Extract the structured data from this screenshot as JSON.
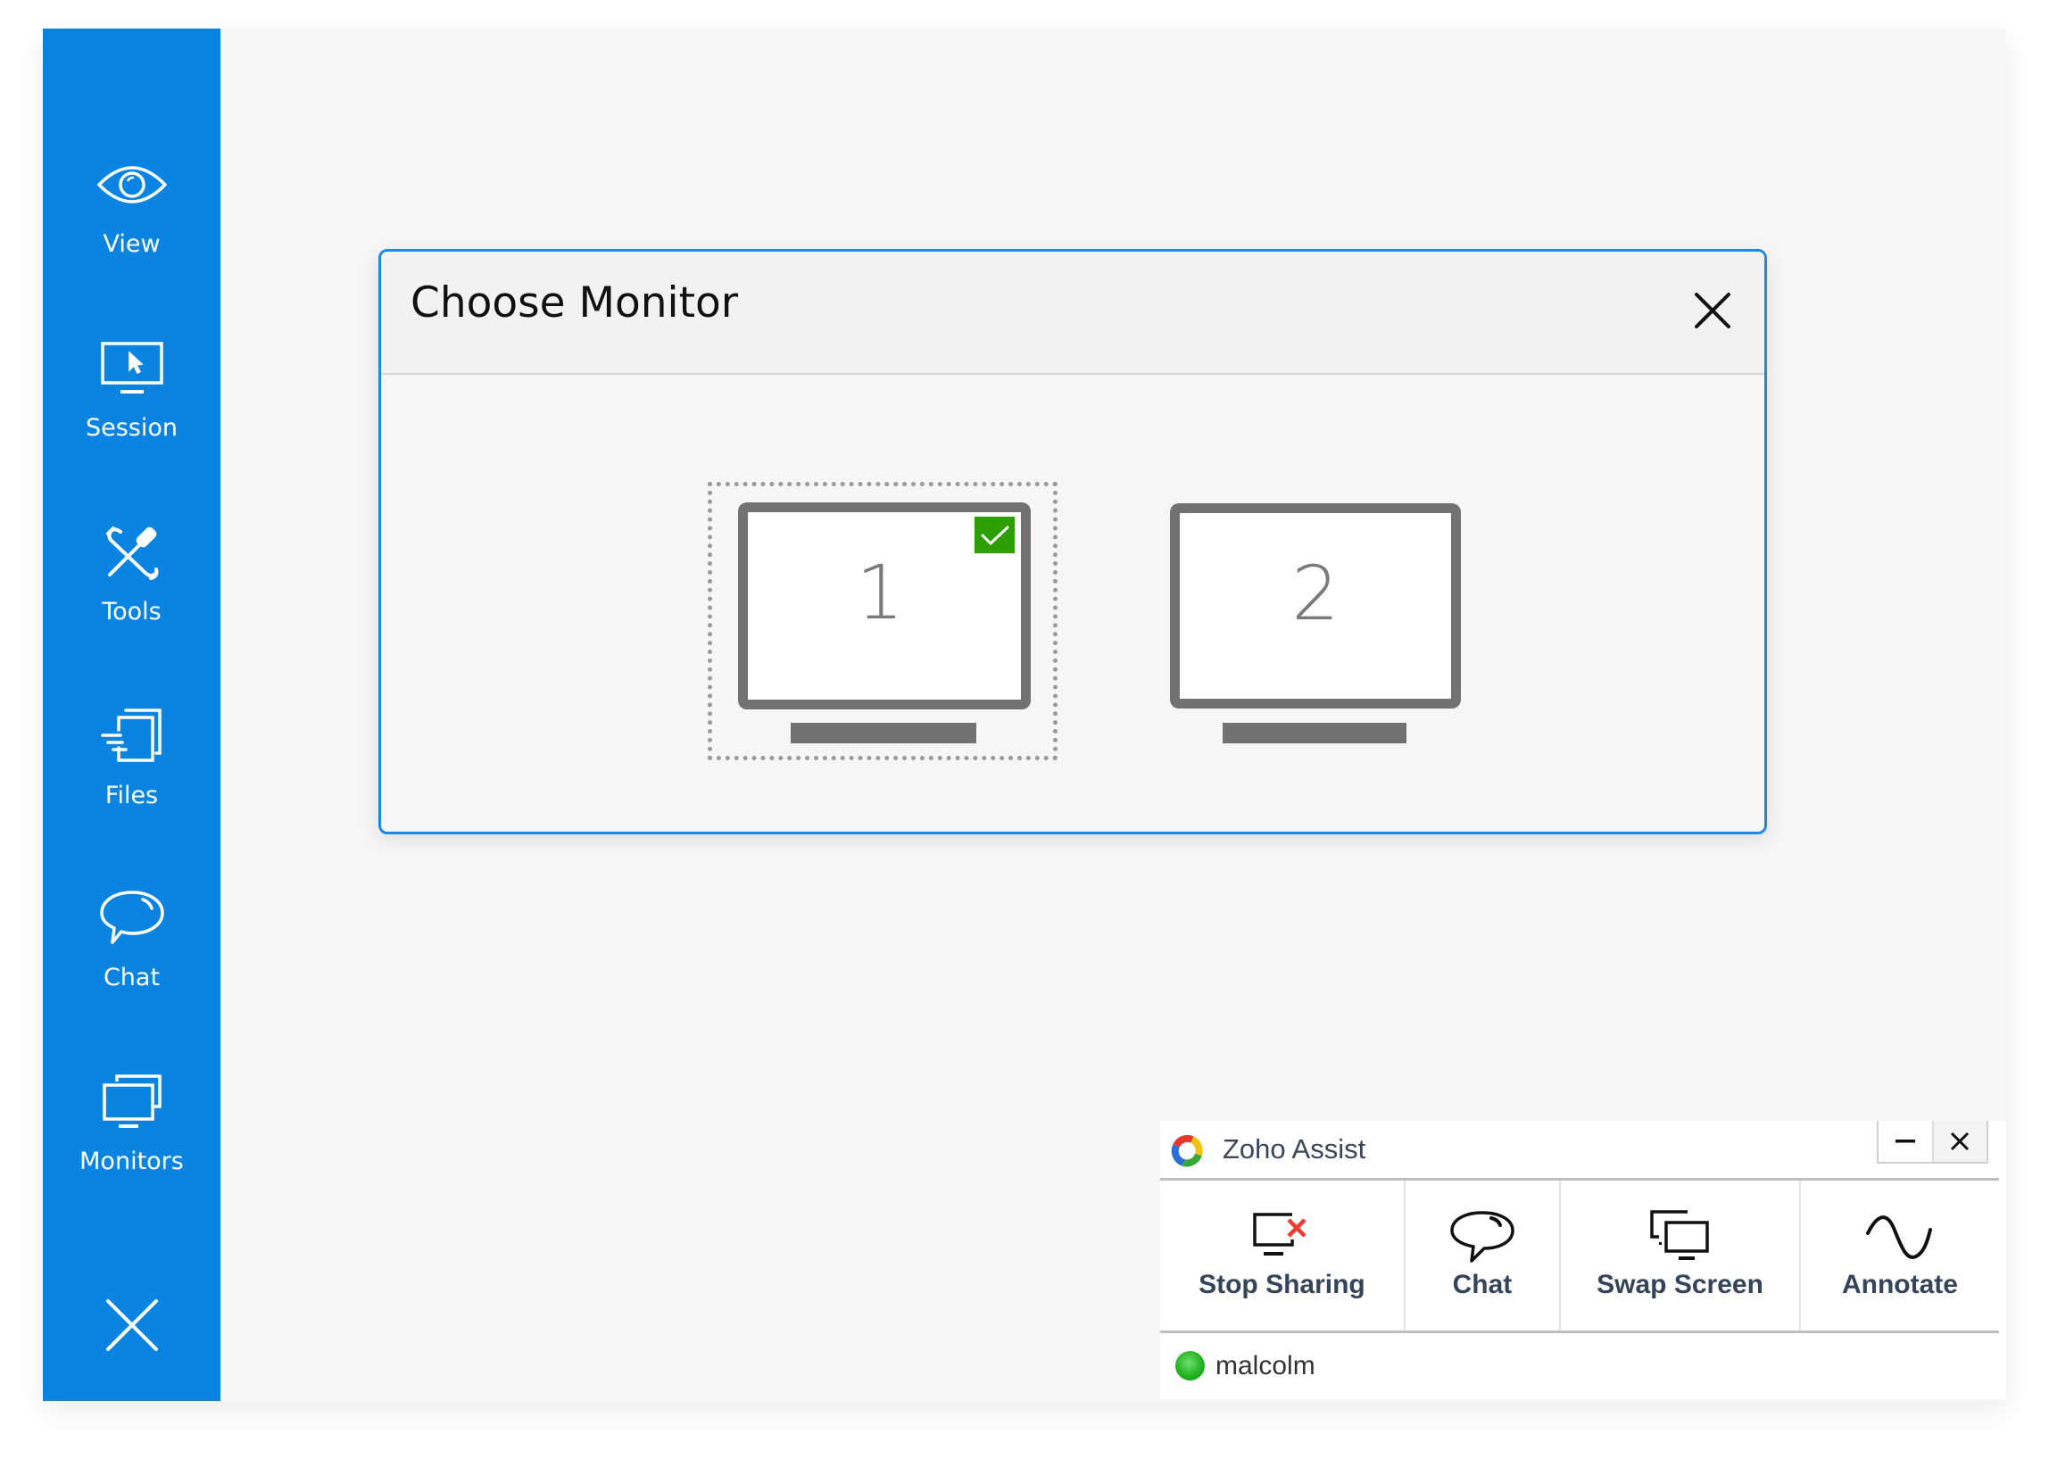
{
  "sidebar": {
    "items": [
      {
        "label": "View",
        "icon": "eye-icon"
      },
      {
        "label": "Session",
        "icon": "session-monitor-cursor-icon"
      },
      {
        "label": "Tools",
        "icon": "tools-icon"
      },
      {
        "label": "Files",
        "icon": "files-icon"
      },
      {
        "label": "Chat",
        "icon": "chat-bubble-icon"
      },
      {
        "label": "Monitors",
        "icon": "monitors-icon"
      }
    ],
    "close_icon": "close-icon"
  },
  "dialog": {
    "title": "Choose Monitor",
    "close_icon": "close-icon",
    "monitors": [
      {
        "number": "1",
        "selected": true
      },
      {
        "number": "2",
        "selected": false
      }
    ],
    "colors": {
      "border": "#1e88e5",
      "check": "#2e9e05"
    }
  },
  "zoho_panel": {
    "title": "Zoho Assist",
    "minimize_label": "–",
    "close_label": "✕",
    "actions": [
      {
        "label": "Stop Sharing",
        "icon": "stop-sharing-icon"
      },
      {
        "label": "Chat",
        "icon": "chat-icon"
      },
      {
        "label": "Swap Screen",
        "icon": "swap-screen-icon"
      },
      {
        "label": "Annotate",
        "icon": "annotate-icon"
      }
    ],
    "user": {
      "name": "malcolm",
      "status": "online",
      "status_color": "#22b322"
    }
  },
  "theme": {
    "sidebar_color": "#0a84e0",
    "background": "#f6f6f6"
  }
}
